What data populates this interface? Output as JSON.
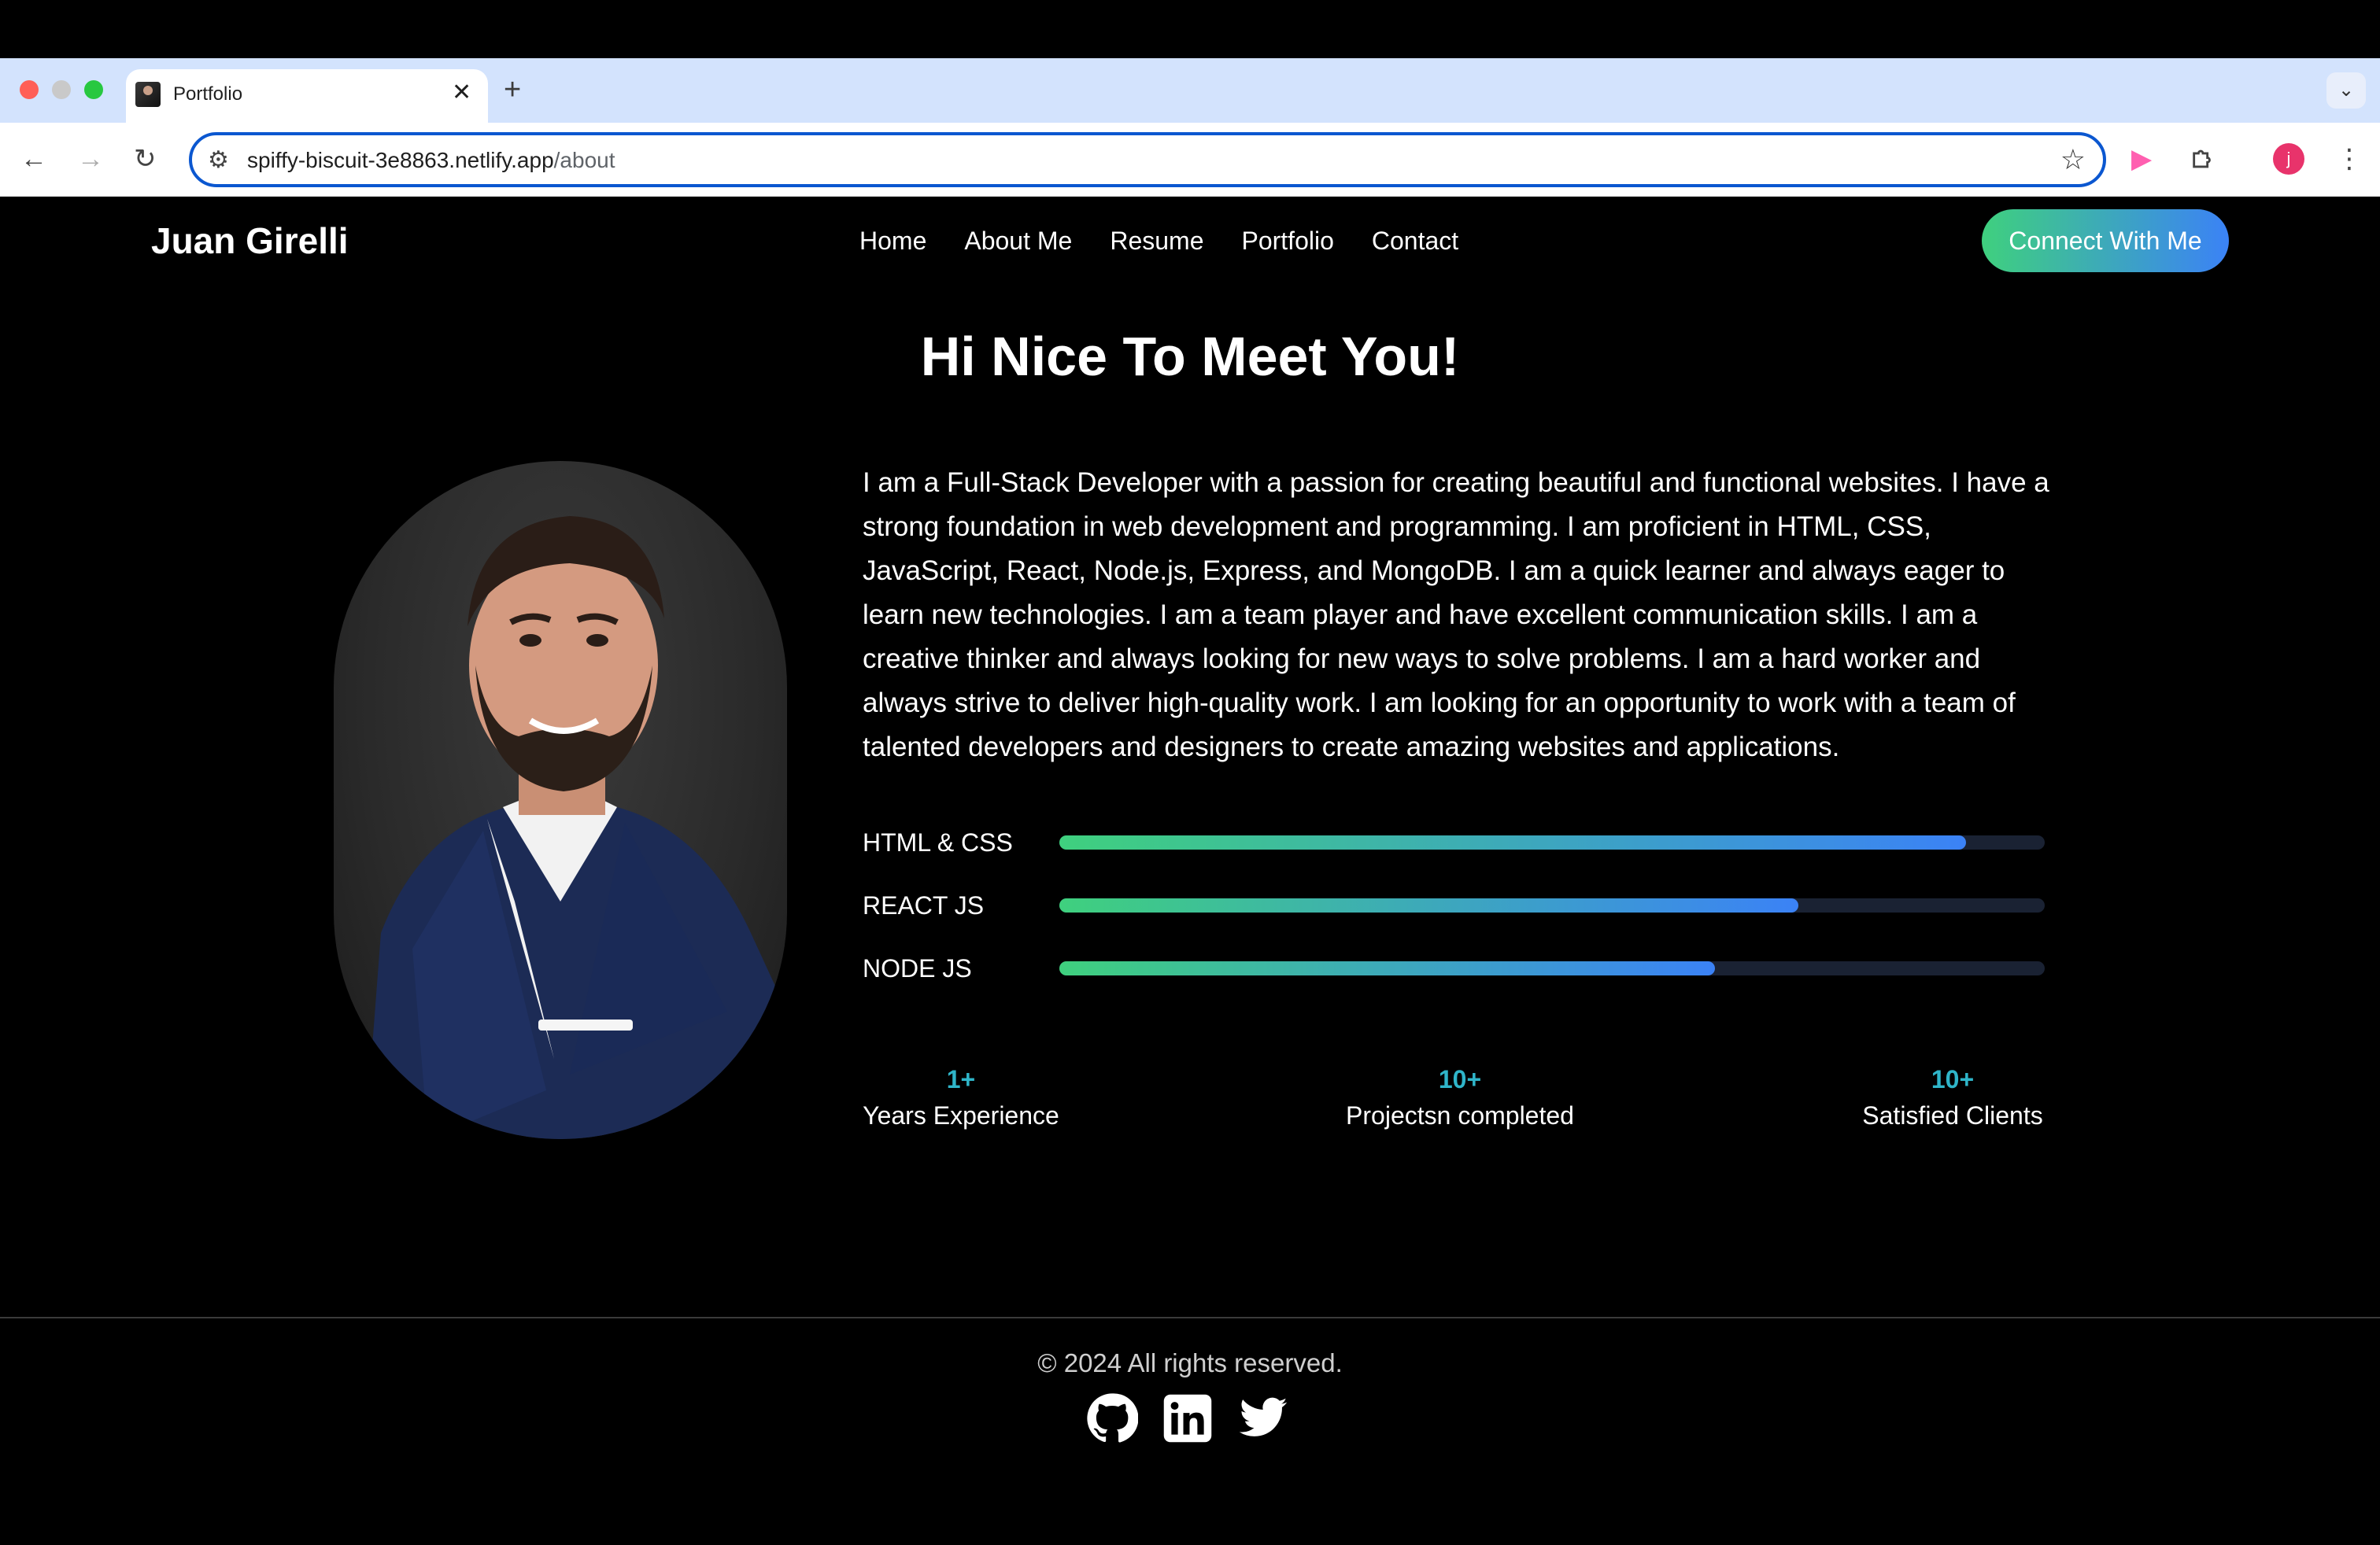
{
  "browser": {
    "tab_title": "Portfolio",
    "tab_close": "✕",
    "new_tab": "+",
    "tab_menu": "⌄",
    "url_host": "spiffy-biscuit-3e8863.netlify.app",
    "url_path": "/about",
    "profile_initial": "j"
  },
  "header": {
    "brand": "Juan Girelli",
    "nav": [
      "Home",
      "About Me",
      "Resume",
      "Portfolio",
      "Contact"
    ],
    "cta": "Connect With Me"
  },
  "about": {
    "heading": "Hi Nice To Meet You!",
    "bio": "I am a Full-Stack Developer with a passion for creating beautiful and functional websites. I have a strong foundation in web development and programming. I am proficient in HTML, CSS, JavaScript, React, Node.js, Express, and MongoDB. I am a quick learner and always eager to learn new technologies. I am a team player and have excellent communication skills. I am a creative thinker and always looking for new ways to solve problems. I am a hard worker and always strive to deliver high-quality work. I am looking for an opportunity to work with a team of talented developers and designers to create amazing websites and applications.",
    "skills": [
      {
        "label": "HTML & CSS",
        "level": 0.92
      },
      {
        "label": "REACT JS",
        "level": 0.75
      },
      {
        "label": "NODE JS",
        "level": 0.665
      }
    ],
    "stats": [
      {
        "value": "1+",
        "label": "Years Experience"
      },
      {
        "value": "10+",
        "label": "Projectsn completed"
      },
      {
        "value": "10+",
        "label": "Satisfied Clients"
      }
    ]
  },
  "footer": {
    "copyright": "© 2024 All rights reserved.",
    "social_icons": [
      "github-icon",
      "linkedin-icon",
      "twitter-icon"
    ]
  },
  "colors": {
    "accent_start": "#3fd07e",
    "accent_end": "#3b82f6",
    "stat_number": "#2fb5c9",
    "omnibox_border": "#0b57d0"
  }
}
